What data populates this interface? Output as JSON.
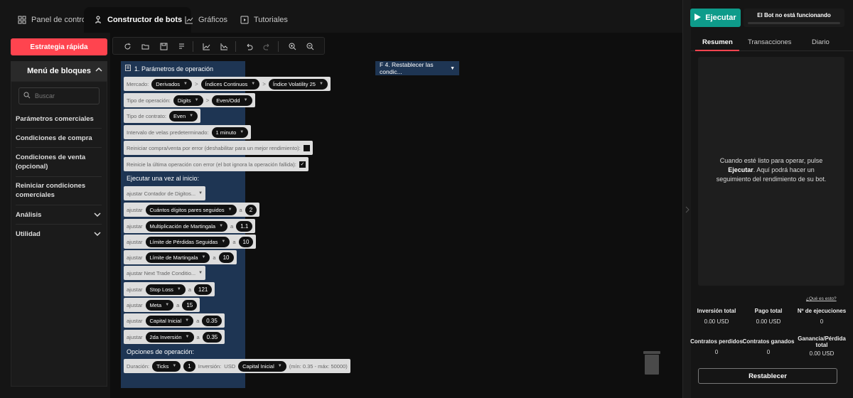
{
  "tabs": [
    {
      "label": "Panel de control",
      "icon": "dashboard-icon"
    },
    {
      "label": "Constructor de bots",
      "icon": "bot-builder-icon"
    },
    {
      "label": "Gráficos",
      "icon": "chart-icon"
    },
    {
      "label": "Tutoriales",
      "icon": "tutorials-icon"
    }
  ],
  "sidebar": {
    "quick_strategy": "Estrategia rápida",
    "menu_title": "Menú de bloques",
    "search_placeholder": "Buscar",
    "items": [
      "Parámetros comerciales",
      "Condiciones de compra",
      "Condiciones de venta (opcional)",
      "Reiniciar condiciones comerciales",
      "Análisis",
      "Utilidad"
    ]
  },
  "toolbar": {
    "icons": [
      "reset-icon",
      "open-icon",
      "save-icon",
      "sort-icon",
      "chart-line-icon",
      "chart-down-icon",
      "undo-icon",
      "redo-icon",
      "zoom-in-icon",
      "zoom-out-icon"
    ]
  },
  "workspace": {
    "block1_title": "1. Parámetros de operación",
    "market_label": "Mercado:",
    "market": [
      "Derivados",
      "Índices Continuos",
      "Índice Volatility 25"
    ],
    "trade_type_label": "Tipo de operación:",
    "trade_type": [
      "Digits",
      "Even/Odd"
    ],
    "contract_type_label": "Tipo de contrato:",
    "contract_type": "Even",
    "candle_label": "Intervalo de velas predeterminado:",
    "candle": "1 minuto",
    "restart_error_label": "Reiniciar compra/venta por error (deshabilitar para un mejor rendimiento):",
    "restart_last_label": "Reinicie la última operación con error (el bot ignora la operación fallida):",
    "run_once_label": "Ejecutar una vez al inicio:",
    "set_word": "ajustar",
    "to_word": "a",
    "set_counter": "ajustar Contador de Digitos...",
    "set_next_trade": "ajustar Next Trade Conditio...",
    "vars": [
      {
        "name": "Cuántos dígitos pares seguidos",
        "value": "2"
      },
      {
        "name": "Multiplicación de Martingala",
        "value": "1.1"
      },
      {
        "name": "Límite de Pérdidas Seguidas",
        "value": "10"
      },
      {
        "name": "Límite de Martingala",
        "value": "10"
      },
      {
        "name": "Stop Loss",
        "value": "121"
      },
      {
        "name": "Meta",
        "value": "15"
      },
      {
        "name": "Capital Inicial",
        "value": "0.35"
      },
      {
        "name": "2da Inversión",
        "value": "0.35"
      }
    ],
    "options_label": "Opciones de operación:",
    "duration_label": "Duración:",
    "duration_unit": "Ticks",
    "duration_value": "1",
    "investment_label": "Inversión:",
    "currency": "USD",
    "investment_var": "Capital Inicial",
    "investment_range": "(mín: 0.35 - máx: 50000)",
    "f4_title": "F 4. Restablecer las condic..."
  },
  "right": {
    "run_label": "Ejecutar",
    "status": "El Bot no está funcionando",
    "tabs": [
      "Resumen",
      "Transacciones",
      "Diario"
    ],
    "msg_pre": "Cuando esté listo para operar, pulse",
    "msg_bold": "Ejecutar",
    "msg_post": ". Aquí podrá hacer un seguimiento del rendimiento de su bot.",
    "what_is": "¿Qué es esto?",
    "stats": [
      {
        "label": "Inversión total",
        "value": "0.00 USD"
      },
      {
        "label": "Pago total",
        "value": "0.00 USD"
      },
      {
        "label": "Nº de ejecuciones",
        "value": "0"
      },
      {
        "label": "Contratos perdidos",
        "value": "0"
      },
      {
        "label": "Contratos ganados",
        "value": "0"
      },
      {
        "label": "Ganancia/Pérdida total",
        "value": "0.00 USD"
      }
    ],
    "reset_label": "Restablecer"
  },
  "colors": {
    "accent": "#ff444f",
    "run": "#0e9b8a",
    "block": "#1e3553"
  }
}
